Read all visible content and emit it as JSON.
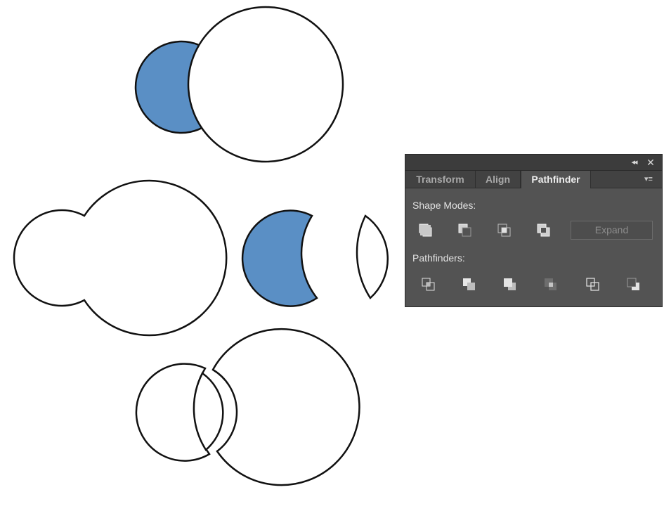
{
  "panel": {
    "tabs": [
      {
        "label": "Transform",
        "active": false
      },
      {
        "label": "Align",
        "active": false
      },
      {
        "label": "Pathfinder",
        "active": true
      }
    ],
    "collapse_glyph": "◂◂",
    "close_glyph": "✕",
    "menu_glyph": "▾≡",
    "shape_modes_label": "Shape Modes:",
    "pathfinders_label": "Pathfinders:",
    "expand_label": "Expand",
    "shape_mode_icons": [
      "unite-icon",
      "minus-front-icon",
      "intersect-icon",
      "exclude-icon"
    ],
    "pathfinder_icons": [
      "divide-icon",
      "trim-icon",
      "merge-icon",
      "crop-icon",
      "outline-icon",
      "minus-back-icon"
    ]
  },
  "colors": {
    "shape_fill_blue": "#5a8fc5",
    "shape_stroke": "#111111",
    "panel_bg": "#535353",
    "panel_tab_bg": "#424242",
    "panel_text": "#e2e2e2"
  }
}
